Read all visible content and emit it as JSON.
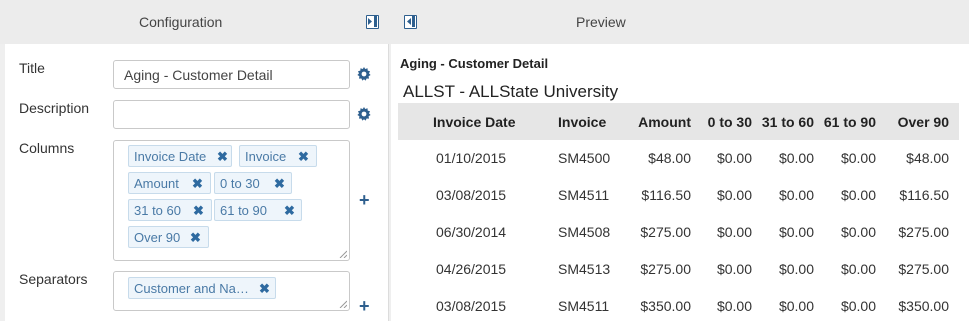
{
  "header": {
    "config_title": "Configuration",
    "preview_title": "Preview"
  },
  "config": {
    "title_label": "Title",
    "title_value": "Aging - Customer Detail",
    "description_label": "Description",
    "description_value": "",
    "columns_label": "Columns",
    "columns": [
      "Invoice Date",
      "Invoice",
      "Amount",
      "0 to 30",
      "31 to 60",
      "61 to 90",
      "Over 90"
    ],
    "separators_label": "Separators",
    "separators": [
      "Customer and Na…"
    ]
  },
  "preview": {
    "report_title": "Aging - Customer Detail",
    "company": "ALLST - ALLState University",
    "table_headers": [
      "Invoice Date",
      "Invoice",
      "Amount",
      "0 to 30",
      "31 to 60",
      "61 to 90",
      "Over 90"
    ],
    "rows": [
      [
        "01/10/2015",
        "SM4500",
        "$48.00",
        "$0.00",
        "$0.00",
        "$0.00",
        "$48.00"
      ],
      [
        "03/08/2015",
        "SM4511",
        "$116.50",
        "$0.00",
        "$0.00",
        "$0.00",
        "$116.50"
      ],
      [
        "06/30/2014",
        "SM4508",
        "$275.00",
        "$0.00",
        "$0.00",
        "$0.00",
        "$275.00"
      ],
      [
        "04/26/2015",
        "SM4513",
        "$275.00",
        "$0.00",
        "$0.00",
        "$0.00",
        "$275.00"
      ],
      [
        "03/08/2015",
        "SM4511",
        "$350.00",
        "$0.00",
        "$0.00",
        "$0.00",
        "$350.00"
      ]
    ]
  },
  "colors": {
    "accent": "#2e5f8e",
    "tag_bg": "#eef5fb",
    "tag_text": "#4a7aa6",
    "header_bg": "#ececec",
    "table_header_bg": "#e6e6e6"
  }
}
